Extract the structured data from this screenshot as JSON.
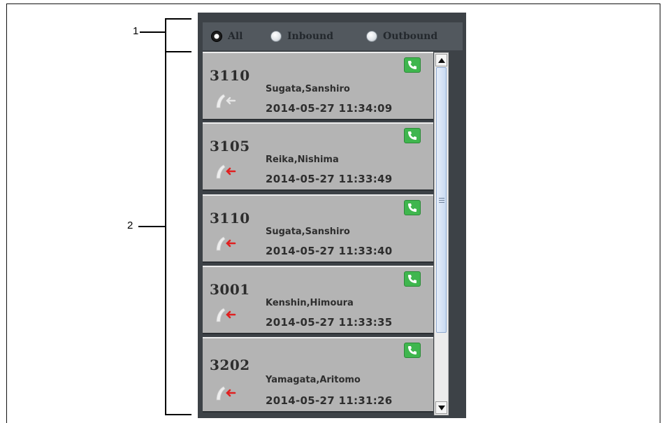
{
  "callouts": {
    "filter": "1",
    "list": "2"
  },
  "filters": [
    {
      "label": "All",
      "selected": true
    },
    {
      "label": "Inbound",
      "selected": false
    },
    {
      "label": "Outbound",
      "selected": false
    }
  ],
  "calls": [
    {
      "number": "3110",
      "name": "Sugata,Sanshiro",
      "time": "2014-05-27 11:34:09",
      "direction": "missed-incoming-icon",
      "action": "phone-icon"
    },
    {
      "number": "3105",
      "name": "Reika,Nishima",
      "time": "2014-05-27 11:33:49",
      "direction": "incoming-call-icon",
      "action": "phone-icon"
    },
    {
      "number": "3110",
      "name": "Sugata,Sanshiro",
      "time": "2014-05-27 11:33:40",
      "direction": "incoming-call-icon",
      "action": "phone-icon"
    },
    {
      "number": "3001",
      "name": "Kenshin,Himoura",
      "time": "2014-05-27 11:33:35",
      "direction": "incoming-call-icon",
      "action": "phone-icon"
    },
    {
      "number": "3202",
      "name": "Yamagata,Aritomo",
      "time": "2014-05-27 11:31:26",
      "direction": "incoming-call-icon",
      "action": "phone-icon"
    }
  ],
  "colors": {
    "panel": "#3d4247",
    "item": "#b4b4b4",
    "call_badge": "#3fb64e",
    "inbound_arrow": "#e02020",
    "missed_arrow": "#e0e0e0"
  }
}
